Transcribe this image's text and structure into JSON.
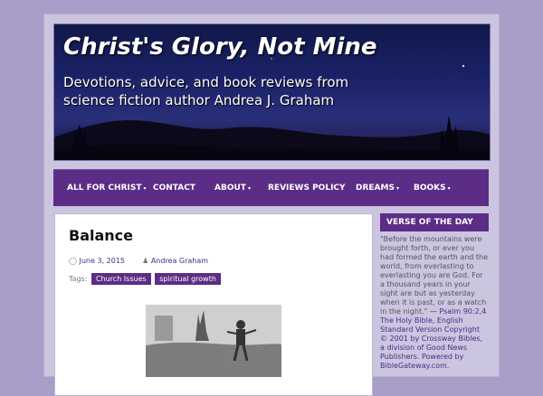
{
  "header": {
    "title": "Christ's Glory, Not Mine",
    "description": "Devotions, advice, and book reviews from science fiction author Andrea J. Graham"
  },
  "nav": {
    "items": [
      {
        "label": "ALL FOR CHRIST",
        "caret": "▾"
      },
      {
        "label": "CONTACT"
      },
      {
        "label": "ABOUT",
        "caret": "▾"
      },
      {
        "label": "REVIEWS POLICY"
      },
      {
        "label": "DREAMS",
        "caret": "▾"
      },
      {
        "label": "BOOKS",
        "caret": "▾"
      }
    ]
  },
  "post": {
    "title": "Balance",
    "date": "June 3, 2015",
    "author": "Andrea Graham",
    "tags_label": "Tags:",
    "tags": [
      "Church Issues",
      "spiritual growth"
    ]
  },
  "sidebar": {
    "widget_title": "VERSE OF THE DAY",
    "verse_text": "\"Before the mountains were brought forth, or ever you had formed the earth and the world, from everlasting to everlasting you are God. For a thousand years in your sight are but as yesterday when it is past, or as a watch in the night.\"",
    "verse_ref": "— Psalm 90:2,4",
    "copyright": "The Holy Bible, English Standard Version Copyright © 2001 by Crossway Bibles, a division of Good News Publishers.",
    "powered_by": "Powered by BibleGateway.com."
  },
  "colors": {
    "background": "#a89ec8",
    "accent": "#5b2d86"
  }
}
